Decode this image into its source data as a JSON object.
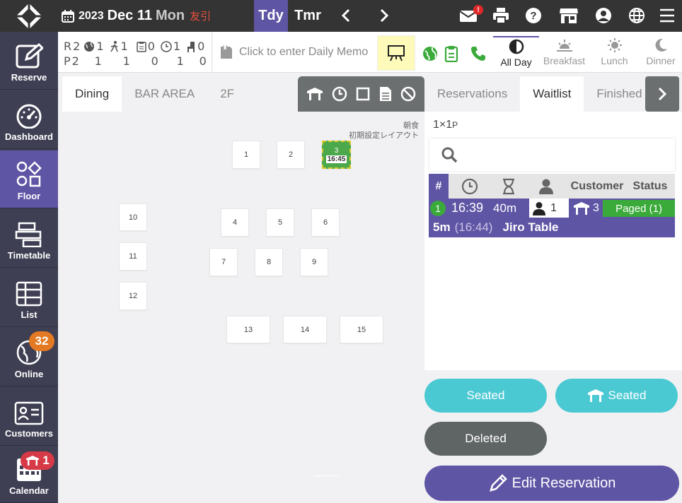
{
  "topbar": {
    "year": "2023",
    "month_day": "Dec 11",
    "weekday": "Mon",
    "rokuyo": "友引",
    "today": "Tdy",
    "tomorrow": "Tmr",
    "mail_badge": "!"
  },
  "sidebar": {
    "items": [
      {
        "label": "Reserve"
      },
      {
        "label": "Dashboard"
      },
      {
        "label": "Floor"
      },
      {
        "label": "Timetable"
      },
      {
        "label": "List"
      },
      {
        "label": "Online",
        "badge": "32"
      },
      {
        "label": "Customers"
      },
      {
        "label": "Calendar",
        "badge": "1"
      }
    ]
  },
  "stats": {
    "r_label": "R",
    "p_label": "P",
    "r": [
      "2",
      "1",
      "1",
      "0",
      "1",
      "0"
    ],
    "p": [
      "2",
      "1",
      "1",
      "0",
      "1",
      "0"
    ]
  },
  "memo": {
    "placeholder": "Click to enter Daily Memo"
  },
  "shifts": [
    {
      "label": "All Day"
    },
    {
      "label": "Breakfast"
    },
    {
      "label": "Lunch"
    },
    {
      "label": "Dinner"
    }
  ],
  "floor": {
    "tabs": [
      "Dining",
      "BAR AREA",
      "2F"
    ],
    "layout_line1": "朝食",
    "layout_line2": "初期設定レイアウト",
    "tables": [
      "1",
      "2",
      "3",
      "4",
      "5",
      "6",
      "7",
      "8",
      "9",
      "10",
      "11",
      "12",
      "13",
      "14",
      "15"
    ],
    "occupied_time": "16:45"
  },
  "reservations": {
    "tabs": [
      "Reservations",
      "Waitlist",
      "Finished"
    ],
    "ratio_a": "1",
    "ratio_x": "×",
    "ratio_b": "1",
    "ratio_unit": "P",
    "headers": {
      "hash": "#",
      "customer": "Customer",
      "status": "Status"
    },
    "row": {
      "num": "1",
      "time": "16:39",
      "wait": "40m",
      "people": "1",
      "table": "3",
      "status": "Paged (1)",
      "mins": "5m",
      "paged_time": "(16:44)",
      "name": "Jiro Table"
    }
  },
  "actions": {
    "seated": "Seated",
    "table_seated": "Seated",
    "deleted": "Deleted",
    "edit": "Edit Reservation"
  },
  "colors": {
    "accent": "#5f55a5",
    "cyan": "#4bc9d3",
    "green": "#3aaa3a",
    "orange": "#e37a23",
    "red": "#d63a47"
  }
}
